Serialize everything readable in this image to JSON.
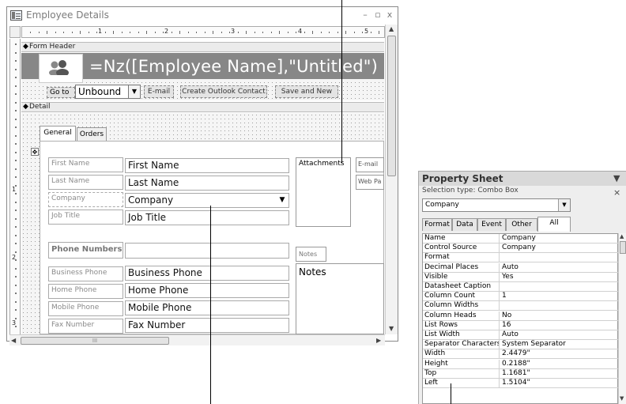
{
  "window": {
    "title": "Employee Details",
    "controls": {
      "minimize": "–",
      "restore": "▫",
      "close": "x"
    }
  },
  "ruler": {
    "numbers": [
      "1",
      "2",
      "3",
      "4",
      "5"
    ],
    "vnumbers": [
      "1",
      "2",
      "3"
    ]
  },
  "sections": {
    "form_header": "Form Header",
    "detail": "Detail"
  },
  "header": {
    "title_expression": "=Nz([Employee Name],\"Untitled\")",
    "goto_label": "Go to",
    "goto_value": "Unbound",
    "buttons": [
      "E-mail",
      "Create Outlook Contact",
      "Save and New"
    ]
  },
  "tabs": [
    "General",
    "Orders"
  ],
  "fields": [
    {
      "label": "First Name",
      "value": "First Name"
    },
    {
      "label": "Last Name",
      "value": "Last Name"
    },
    {
      "label": "Company",
      "value": "Company",
      "dropdown": true
    },
    {
      "label": "Job Title",
      "value": "Job Title"
    }
  ],
  "phone_section": {
    "heading": "Phone Numbers"
  },
  "phones": [
    {
      "label": "Business Phone",
      "value": "Business Phone"
    },
    {
      "label": "Home Phone",
      "value": "Home Phone"
    },
    {
      "label": "Mobile Phone",
      "value": "Mobile Phone"
    },
    {
      "label": "Fax Number",
      "value": "Fax Number"
    }
  ],
  "right_panel": {
    "attachments": "Attachments",
    "email": "E-mail",
    "webpage": "Web Pa",
    "notes_label": "Notes",
    "notes_box": "Notes"
  },
  "hscroll_grip": "III",
  "property_sheet": {
    "title": "Property Sheet",
    "selection_type": "Selection type:  Combo Box",
    "selected_object": "Company",
    "tabs": [
      "Format",
      "Data",
      "Event",
      "Other",
      "All"
    ],
    "active_tab": "All",
    "rows": [
      {
        "name": "Name",
        "value": "Company"
      },
      {
        "name": "Control Source",
        "value": "Company"
      },
      {
        "name": "Format",
        "value": ""
      },
      {
        "name": "Decimal Places",
        "value": "Auto"
      },
      {
        "name": "Visible",
        "value": "Yes"
      },
      {
        "name": "Datasheet Caption",
        "value": ""
      },
      {
        "name": "Column Count",
        "value": "1"
      },
      {
        "name": "Column Widths",
        "value": ""
      },
      {
        "name": "Column Heads",
        "value": "No"
      },
      {
        "name": "List Rows",
        "value": "16"
      },
      {
        "name": "List Width",
        "value": "Auto"
      },
      {
        "name": "Separator Characters",
        "value": "System Separator"
      },
      {
        "name": "Width",
        "value": "2.4479\""
      },
      {
        "name": "Height",
        "value": "0.2188\""
      },
      {
        "name": "Top",
        "value": "1.1681\""
      },
      {
        "name": "Left",
        "value": "1.5104\""
      }
    ]
  }
}
